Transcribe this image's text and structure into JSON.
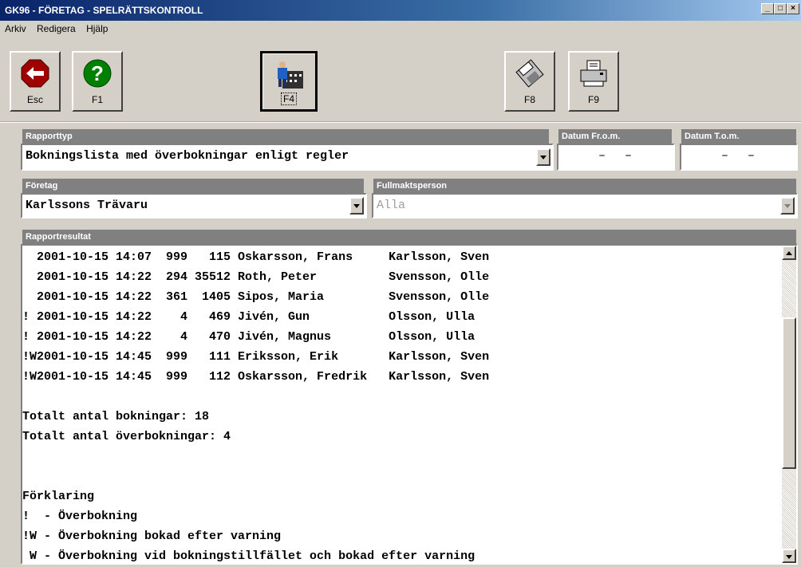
{
  "window": {
    "title": "GK96 - FÖRETAG - SPELRÄTTSKONTROLL"
  },
  "menu": [
    {
      "label": "Arkiv"
    },
    {
      "label": "Redigera"
    },
    {
      "label": "Hjälp"
    }
  ],
  "toolbar": {
    "esc_label": "Esc",
    "f1_label": "F1",
    "f4_label": "F4",
    "f8_label": "F8",
    "f9_label": "F9"
  },
  "form": {
    "rapporttyp_label": "Rapporttyp",
    "rapporttyp_value": "Bokningslista med överbokningar enligt regler",
    "datum_from_label": "Datum Fr.o.m.",
    "datum_from_value": "–  –",
    "datum_tom_label": "Datum T.o.m.",
    "datum_tom_value": "–  –",
    "foretag_label": "Företag",
    "foretag_value": "Karlssons Trävaru",
    "fullmakt_label": "Fullmaktsperson",
    "fullmakt_value": "Alla",
    "result_label": "Rapportresultat"
  },
  "result": {
    "lines": [
      "  2001-10-15 14:07  999   115 Oskarsson, Frans     Karlsson, Sven",
      "  2001-10-15 14:22  294 35512 Roth, Peter          Svensson, Olle",
      "  2001-10-15 14:22  361  1405 Sipos, Maria         Svensson, Olle",
      "! 2001-10-15 14:22    4   469 Jivén, Gun           Olsson, Ulla",
      "! 2001-10-15 14:22    4   470 Jivén, Magnus        Olsson, Ulla",
      "!W2001-10-15 14:45  999   111 Eriksson, Erik       Karlsson, Sven",
      "!W2001-10-15 14:45  999   112 Oskarsson, Fredrik   Karlsson, Sven",
      "",
      "Totalt antal bokningar: 18",
      "Totalt antal överbokningar: 4",
      "",
      "",
      "Förklaring",
      "!  - Överbokning",
      "!W - Överbokning bokad efter varning",
      " W - Överbokning vid bokningstillfället och bokad efter varning"
    ]
  }
}
